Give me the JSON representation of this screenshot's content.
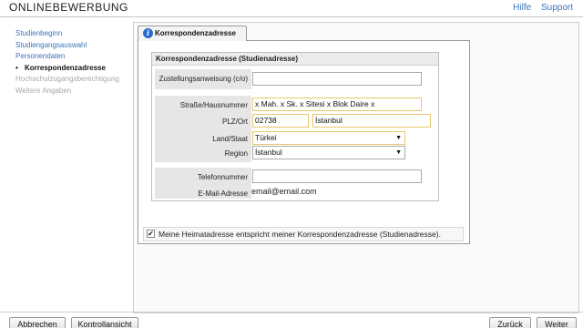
{
  "header": {
    "title_first": "O",
    "title_rest": "NLINEBEWERBUNG",
    "links": [
      "Hilfe",
      "Support"
    ]
  },
  "sidebar": {
    "items": [
      {
        "label": "Studienbeginn",
        "state": "link"
      },
      {
        "label": "Studiengangsauswahl",
        "state": "link"
      },
      {
        "label": "Personendaten",
        "state": "link"
      },
      {
        "label": "Korrespondenzadresse",
        "state": "current"
      },
      {
        "label": "Hochschulzugangsberechtigung",
        "state": "disabled"
      },
      {
        "label": "Weitere Angaben",
        "state": "disabled"
      }
    ],
    "current_bullet": "•"
  },
  "tab": {
    "icon": "info-icon",
    "icon_glyph": "i",
    "label": "Korrespondenzadresse"
  },
  "form": {
    "section_title": "Korrespondenzadresse (Studienadresse)",
    "fields": {
      "zustellung": {
        "label": "Zustellungsanweisung (c/o)",
        "value": ""
      },
      "strasse": {
        "label": "Straße/Hausnummer",
        "value": "x Mah. x Sk. x Sitesi x Blok Daire x"
      },
      "plz_ort": {
        "label": "PLZ/Ort",
        "plz": "02738",
        "ort": "İstanbul"
      },
      "land": {
        "label": "Land/Staat",
        "value": "Türkei"
      },
      "region": {
        "label": "Region",
        "value": "İstanbul"
      },
      "telefon": {
        "label": "Telefonnummer",
        "value": ""
      },
      "email": {
        "label": "E-Mail-Adresse",
        "value": "email@email.com"
      }
    },
    "select_arrow": "▼",
    "checkbox": {
      "checked": true,
      "mark": "✔",
      "label": "Meine Heimatadresse entspricht meiner Korrespondenzadresse (Studienadresse)."
    }
  },
  "footer": {
    "cancel": "Abbrechen",
    "review": "Kontrollansicht",
    "back": "Zurück",
    "next": "Weiter"
  },
  "colors": {
    "link": "#3b73b9",
    "highlight_border": "#e8c86e",
    "info_icon": "#2a6dcf"
  }
}
